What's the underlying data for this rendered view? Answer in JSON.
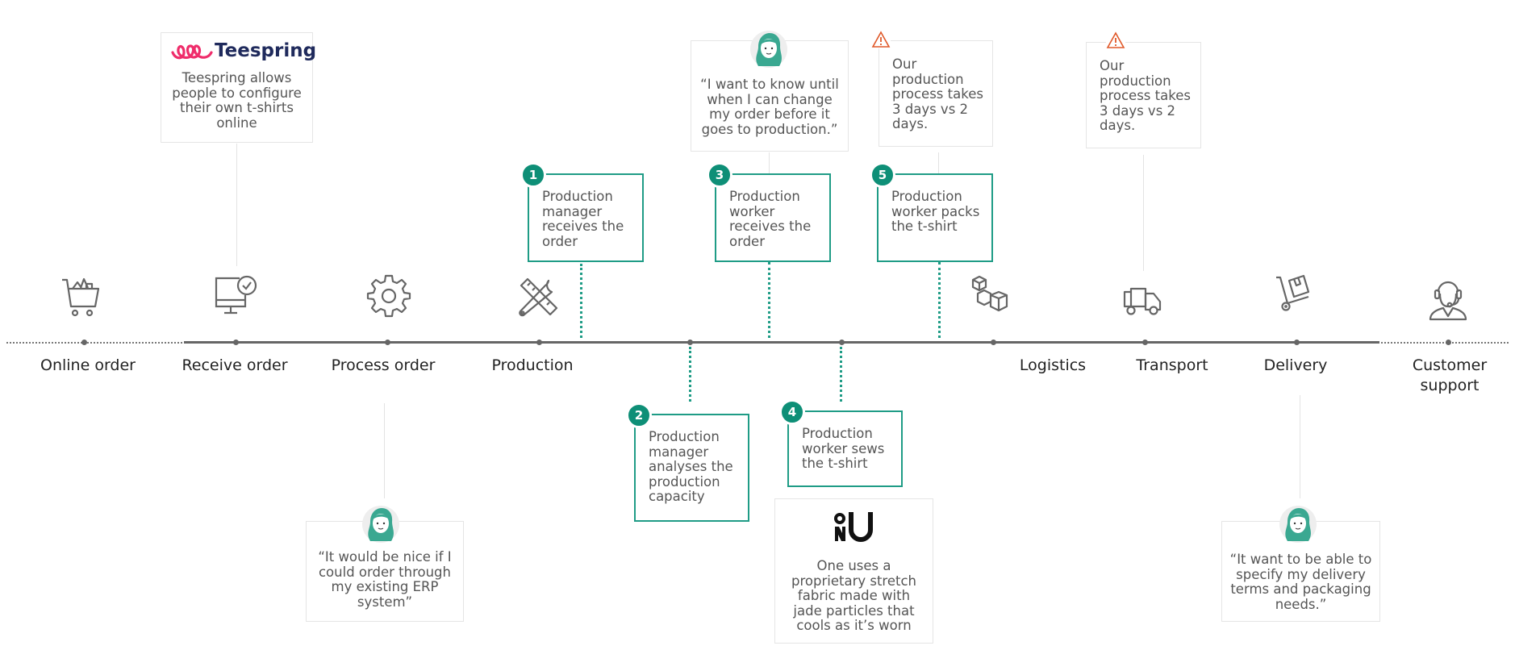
{
  "stages": [
    {
      "id": "online-order",
      "label": "Online order",
      "icon": "shopping-cart-icon"
    },
    {
      "id": "receive-order",
      "label": "Receive order",
      "icon": "monitor-check-icon"
    },
    {
      "id": "process-order",
      "label": "Process order",
      "icon": "gear-icon"
    },
    {
      "id": "production",
      "label": "Production",
      "icon": "tools-icon"
    },
    {
      "id": "logistics",
      "label": "Logistics",
      "icon": "boxes-icon"
    },
    {
      "id": "transport",
      "label": "Transport",
      "icon": "truck-icon"
    },
    {
      "id": "delivery",
      "label": "Delivery",
      "icon": "hand-truck-icon"
    },
    {
      "id": "customer-support",
      "label": "Customer support",
      "icon": "headset-agent-icon"
    }
  ],
  "steps": [
    {
      "number": "1",
      "text": "Production manager receives the order"
    },
    {
      "number": "2",
      "text": "Production manager analyses the production capacity"
    },
    {
      "number": "3",
      "text": "Production worker receives the order"
    },
    {
      "number": "4",
      "text": "Production worker sews the t-shirt"
    },
    {
      "number": "5",
      "text": "Production worker packs the t-shirt"
    }
  ],
  "cards": {
    "teespring": {
      "brand": "Teespring",
      "text": "Teespring allows people to configure their own t-shirts online"
    },
    "quote_change_order": {
      "text": "“I want to know until when I can change my order before it goes to production.”"
    },
    "warning_production_1": {
      "text": "Our production process takes 3 days vs 2 days."
    },
    "warning_production_2": {
      "text": "Our production process takes 3 days vs 2 days."
    },
    "quote_erp": {
      "text": "“It would be nice if I could order through my existing ERP system”"
    },
    "one_brand": {
      "brand": "ONU",
      "text": "One uses a proprietary stretch fabric made with jade particles that cools as it’s worn"
    },
    "quote_delivery": {
      "text": "“It want to be able to specify my delivery terms and packaging needs.”"
    }
  },
  "colors": {
    "accent": "#0e8f77",
    "accent_line": "#1f9c86",
    "warning": "#e0592a",
    "teespring_pink": "#ef2d6b",
    "teespring_navy": "#1f2a5c",
    "axis": "#666666"
  }
}
